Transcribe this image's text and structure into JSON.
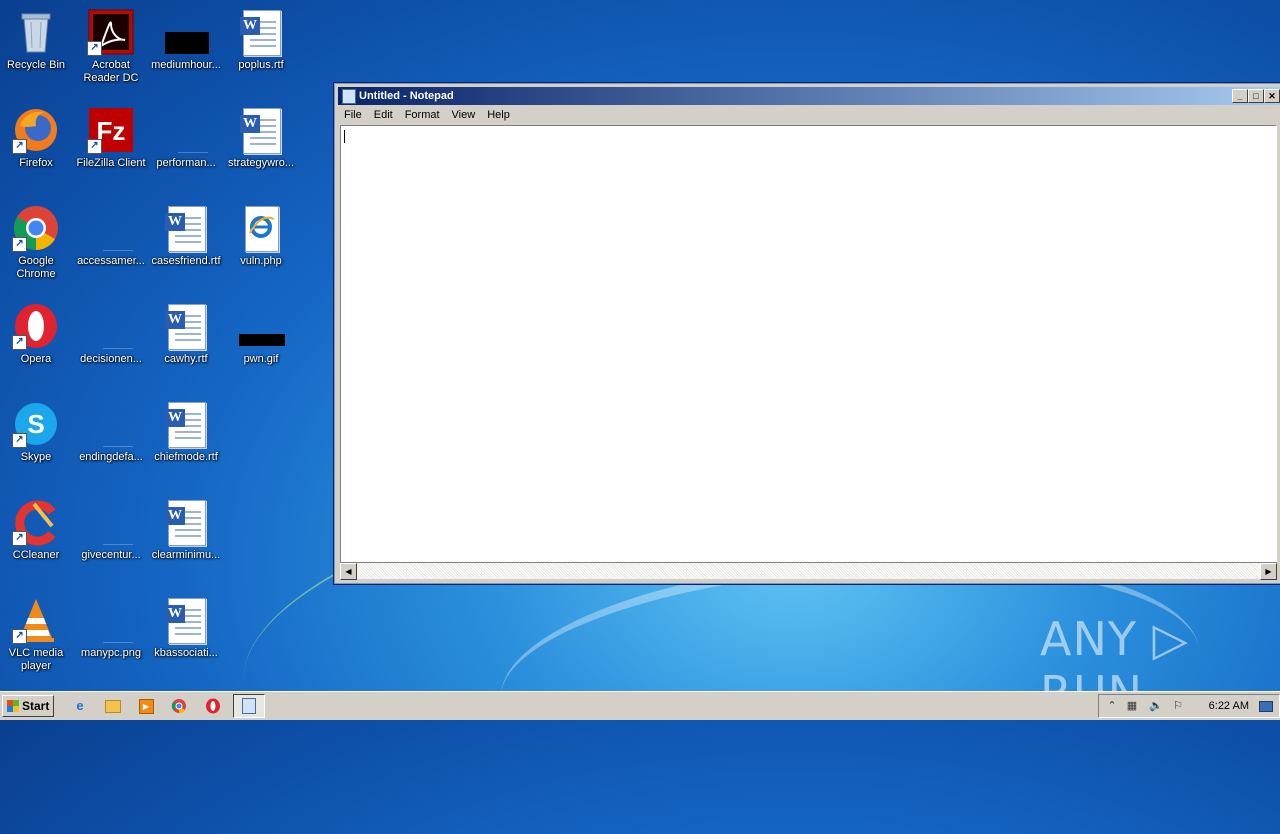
{
  "desktop": {
    "icons": [
      {
        "label": "Recycle Bin",
        "icon": "recycle-bin-icon"
      },
      {
        "label": "Acrobat Reader DC",
        "icon": "acrobat-icon"
      },
      {
        "label": "mediumhour...",
        "icon": "image-thumb-icon"
      },
      {
        "label": "poplus.rtf",
        "icon": "word-doc-icon"
      },
      {
        "label": "Firefox",
        "icon": "firefox-icon"
      },
      {
        "label": "FileZilla Client",
        "icon": "filezilla-icon"
      },
      {
        "label": "performan...",
        "icon": "file-icon"
      },
      {
        "label": "strategywro...",
        "icon": "word-doc-icon"
      },
      {
        "label": "Google Chrome",
        "icon": "chrome-icon"
      },
      {
        "label": "accessamer...",
        "icon": "file-icon"
      },
      {
        "label": "casesfriend.rtf",
        "icon": "word-doc-icon"
      },
      {
        "label": "vuln.php",
        "icon": "ie-doc-icon"
      },
      {
        "label": "Opera",
        "icon": "opera-icon"
      },
      {
        "label": "decisionen...",
        "icon": "file-icon"
      },
      {
        "label": "cawhy.rtf",
        "icon": "word-doc-icon"
      },
      {
        "label": "pwn.gif",
        "icon": "image-thumb-icon"
      },
      {
        "label": "Skype",
        "icon": "skype-icon"
      },
      {
        "label": "endingdefa...",
        "icon": "file-icon"
      },
      {
        "label": "chiefmode.rtf",
        "icon": "word-doc-icon"
      },
      {
        "label": "CCleaner",
        "icon": "ccleaner-icon"
      },
      {
        "label": "givecentur...",
        "icon": "file-icon"
      },
      {
        "label": "clearminimu...",
        "icon": "word-doc-icon"
      },
      {
        "label": "VLC media player",
        "icon": "vlc-icon"
      },
      {
        "label": "manypc.png",
        "icon": "file-icon"
      },
      {
        "label": "kbassociati...",
        "icon": "word-doc-icon"
      }
    ]
  },
  "notepad": {
    "title": "Untitled - Notepad",
    "menu": [
      "File",
      "Edit",
      "Format",
      "View",
      "Help"
    ],
    "content": ""
  },
  "taskbar": {
    "start_label": "Start",
    "clock": "6:22 AM"
  },
  "watermark": "ANY ▷ RUN",
  "colors": {
    "accent": "#0a246a",
    "desktop": "#1566c4",
    "chrome_face": "#d4d0c8"
  }
}
